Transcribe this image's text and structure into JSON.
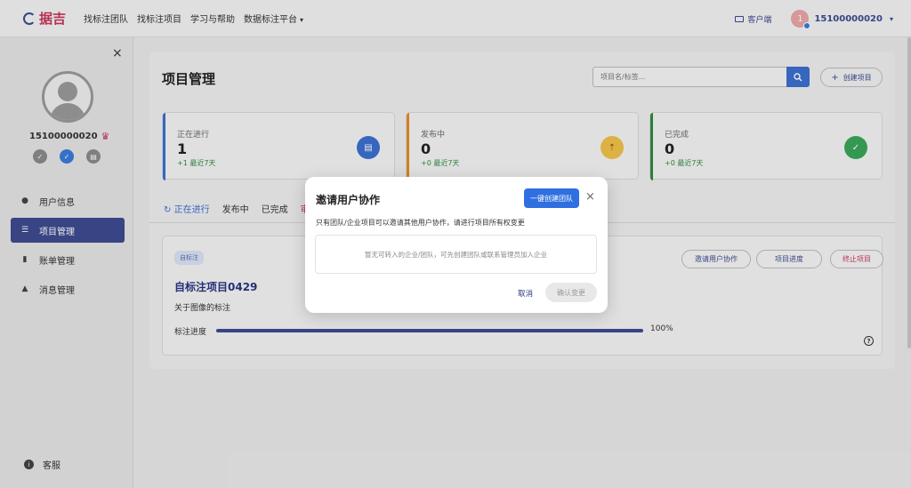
{
  "topbar": {
    "logo_text": "据吉",
    "nav": [
      "找标注团队",
      "找标注项目",
      "学习与帮助",
      "数据标注平台"
    ],
    "nav_caret": "▾",
    "client_label": "客户端",
    "avatar_initial": "1",
    "username": "15100000020",
    "user_caret": "▾"
  },
  "sidebar": {
    "close": "×",
    "username": "15100000020",
    "menu": [
      {
        "icon": "user-icon",
        "label": "用户信息",
        "active": false
      },
      {
        "icon": "list-icon",
        "label": "项目管理",
        "active": true
      },
      {
        "icon": "wallet-icon",
        "label": "账单管理",
        "active": false
      },
      {
        "icon": "bell-icon",
        "label": "消息管理",
        "active": false
      }
    ],
    "service_label": "客服"
  },
  "main": {
    "title": "项目管理",
    "search_placeholder": "项目名/标签...",
    "create_label": "创建项目",
    "stats": [
      {
        "label": "正在进行",
        "value": "1",
        "sub": "+1 最近7天",
        "color": "#3b6fcf",
        "icon_bg": "#3b6fcf"
      },
      {
        "label": "发布中",
        "value": "0",
        "sub": "+0 最近7天",
        "color": "#e88a2a",
        "icon_bg": "#f0c04a"
      },
      {
        "label": "已完成",
        "value": "0",
        "sub": "+0 最近7天",
        "color": "#2f8a3f",
        "icon_bg": "#3aa55a"
      }
    ],
    "tabs": [
      {
        "label": "正在进行",
        "state": "active"
      },
      {
        "label": "发布中",
        "state": ""
      },
      {
        "label": "已完成",
        "state": ""
      },
      {
        "label": "审",
        "state": "red"
      }
    ],
    "tab_refresh_icon": "↻",
    "project": {
      "tag": "自标注",
      "name": "自标注项目0429",
      "desc": "关于图像的标注",
      "progress_label": "标注进度",
      "progress": 100,
      "progress_text": "100%",
      "buttons": [
        "邀请用户协作",
        "项目进度",
        "终止项目"
      ]
    }
  },
  "modal": {
    "title": "邀请用户协作",
    "create_team": "一键创建团队",
    "close": "×",
    "desc": "只有团队/企业项目可以邀请其他用户协作，请进行项目所有权变更",
    "empty_text": "暂无可转入的企业/团队，可先创建团队或联系管理员加入企业",
    "cancel": "取消",
    "confirm": "确认变更"
  },
  "colors": {
    "brand": "#3d4a8f",
    "accent_blue": "#2f6fe0",
    "danger": "#c8335a"
  }
}
